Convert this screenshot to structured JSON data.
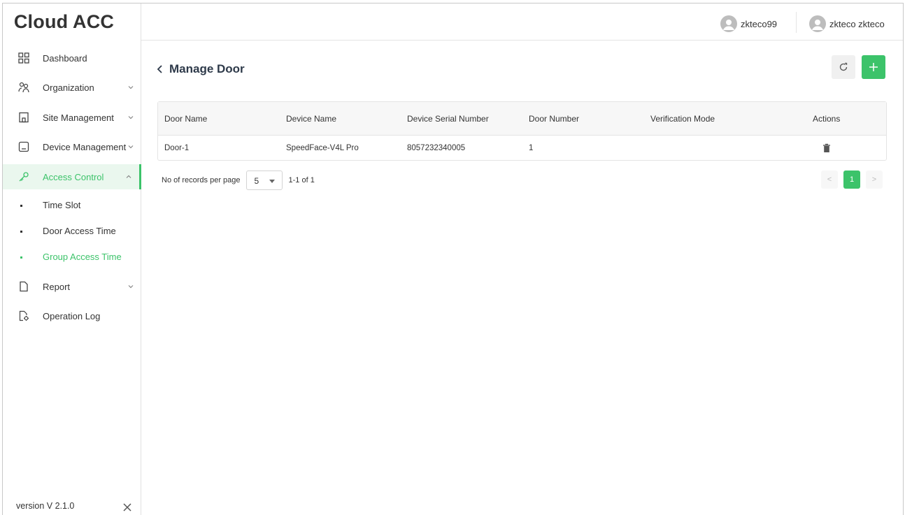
{
  "brand": {
    "title": "Cloud ACC"
  },
  "sidebar": {
    "items": [
      {
        "label": "Dashboard"
      },
      {
        "label": "Organization"
      },
      {
        "label": "Site Management"
      },
      {
        "label": "Device Management"
      },
      {
        "label": "Access Control"
      },
      {
        "label": "Report"
      },
      {
        "label": "Operation Log"
      }
    ],
    "subitems": [
      {
        "label": "Time Slot"
      },
      {
        "label": "Door Access Time"
      },
      {
        "label": "Group Access Time"
      }
    ],
    "version": "version V 2.1.0"
  },
  "header": {
    "users": [
      {
        "name": "zkteco99"
      },
      {
        "name": "zkteco zkteco"
      }
    ]
  },
  "page": {
    "title": "Manage Door"
  },
  "table": {
    "columns": [
      "Door Name",
      "Device Name",
      "Device Serial Number",
      "Door Number",
      "Verification Mode",
      "Actions"
    ],
    "rows": [
      {
        "door_name": "Door-1",
        "device_name": "SpeedFace-V4L Pro",
        "serial": "8057232340005",
        "door_number": "1",
        "verification_mode": ""
      }
    ]
  },
  "pagination": {
    "per_page_label": "No of records per page",
    "per_page_value": "5",
    "range": "1-1 of 1",
    "current_page": "1",
    "prev": "<",
    "next": ">"
  },
  "colors": {
    "accent": "#3cc36a",
    "text": "#333333"
  }
}
